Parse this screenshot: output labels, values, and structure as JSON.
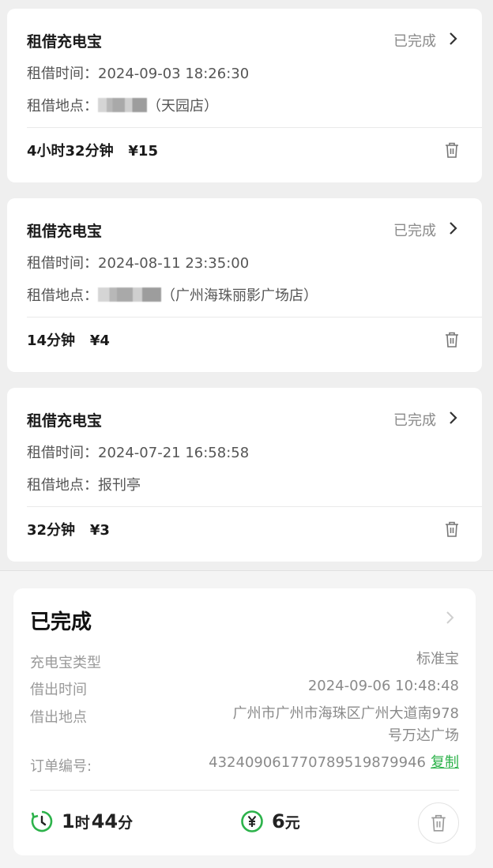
{
  "orders": [
    {
      "title": "租借充电宝",
      "status": "已完成",
      "time_label": "租借时间：",
      "time": "2024-09-03 18:26:30",
      "place_label": "租借地点：",
      "place": "（天园店）",
      "duration": "4小时32分钟",
      "price": "¥15"
    },
    {
      "title": "租借充电宝",
      "status": "已完成",
      "time_label": "租借时间：",
      "time": "2024-08-11 23:35:00",
      "place_label": "租借地点：",
      "place": "（广州海珠丽影广场店）",
      "duration": "14分钟",
      "price": "¥4"
    },
    {
      "title": "租借充电宝",
      "status": "已完成",
      "time_label": "租借时间：",
      "time": "2024-07-21 16:58:58",
      "place_label": "租借地点：",
      "place": "报刊亭",
      "duration": "32分钟",
      "price": "¥3"
    }
  ],
  "detail": {
    "title": "已完成",
    "type_label": "充电宝类型",
    "type_value": "标准宝",
    "time_label": "借出时间",
    "time_value": "2024-09-06 10:48:48",
    "place_label": "借出地点",
    "place_line1": "广州市广州市海珠区广州大道南978",
    "place_line2": "号万达广场",
    "order_label": "订单编号:",
    "order_value": "4324090617707895198799​46",
    "copy_label": "复制",
    "hours": "1",
    "hours_unit": "时",
    "minutes": "44",
    "minutes_unit": "分",
    "amount": "6",
    "amount_unit": "元",
    "accent_color": "#2cb24a"
  }
}
